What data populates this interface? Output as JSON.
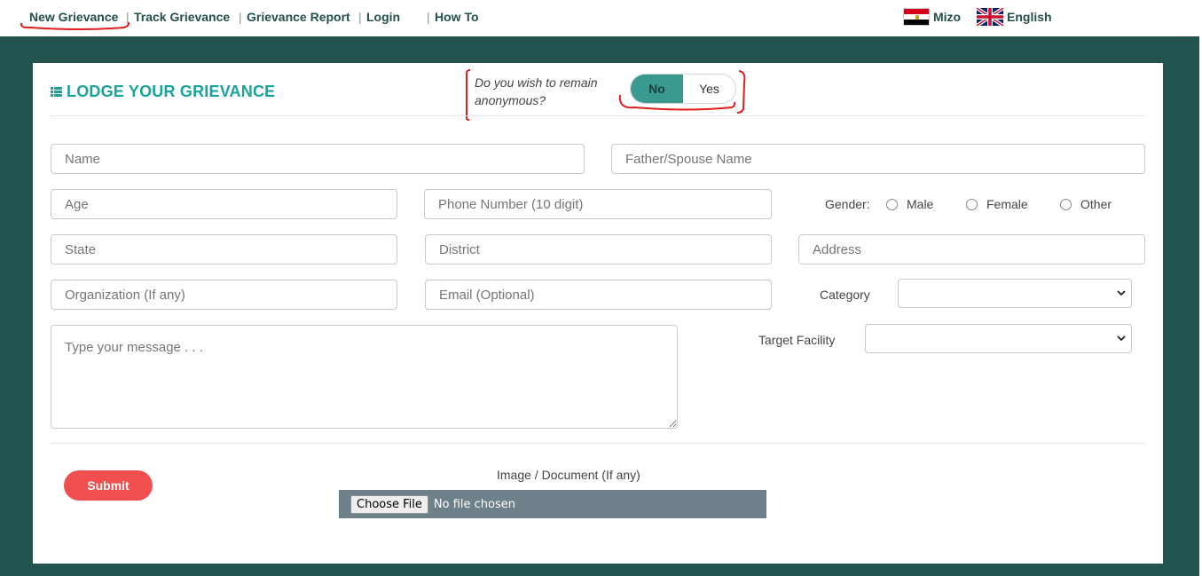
{
  "nav": {
    "items": [
      "New Grievance",
      "Track Grievance",
      "Grievance Report",
      "Login",
      "How To"
    ],
    "separator": "|"
  },
  "languages": [
    {
      "label": "Mizo",
      "icon": "mizoram-flag-icon"
    },
    {
      "label": "English",
      "icon": "uk-flag-icon"
    }
  ],
  "form": {
    "title": "LODGE YOUR GRIEVANCE",
    "title_icon": "list-icon",
    "anonymous_question": "Do you wish to remain anonymous?",
    "anonymous_options": [
      "No",
      "Yes"
    ],
    "anonymous_selected": "No",
    "placeholders": {
      "name": "Name",
      "father_spouse_name": "Father/Spouse Name",
      "age": "Age",
      "phone": "Phone Number (10 digit)",
      "state": "State",
      "district": "District",
      "address": "Address",
      "organization": "Organization (If any)",
      "email": "Email (Optional)",
      "message": "Type your message . . ."
    },
    "gender_label": "Gender:",
    "gender_options": [
      "Male",
      "Female",
      "Other"
    ],
    "category_label": "Category",
    "category_value": "",
    "target_facility_label": "Target Facility",
    "target_facility_value": "",
    "submit_label": "Submit",
    "upload_label": "Image / Document (If any)",
    "choose_file_label": "Choose File",
    "no_file_text": "No file chosen"
  },
  "colors": {
    "header_band": "#23534f",
    "accent_teal": "#1aa39a",
    "submit_red": "#f14f4f",
    "annotation_red": "#e01c1c"
  }
}
